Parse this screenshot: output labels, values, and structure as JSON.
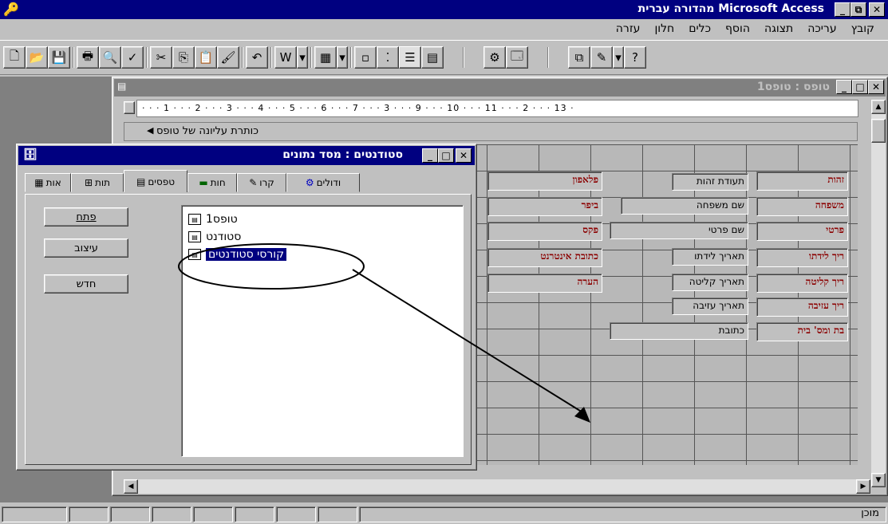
{
  "window": {
    "title": "Microsoft Access מהדורה עברית"
  },
  "menu": {
    "items": [
      "קובץ",
      "עריכה",
      "תצוגה",
      "הוסף",
      "כלים",
      "חלון",
      "עזרה"
    ]
  },
  "form_window": {
    "title": "טופס : טופס1"
  },
  "form_header_label": "כותרת עליונה של טופס",
  "ruler": {
    "numbers": [
      "13",
      "2",
      "11",
      "10",
      "9",
      "3",
      "7",
      "6",
      "5",
      "4",
      "3",
      "2",
      "1"
    ]
  },
  "form_fields": {
    "labels_red": [
      "זהות",
      "משפחה",
      "פרטי",
      "ריך לידתו",
      "ריך קליטה",
      "ריך עזיבה",
      "בת ומס' בית",
      "פלאפון",
      "ביפר",
      "פקס",
      "כתובת אינטרנט",
      "הערה"
    ],
    "labels_black": [
      "תעודת זהות",
      "שם משפחה",
      "שם פרטי",
      "תאריך לידתו",
      "תאריך קליטה",
      "תאריך עזיבה",
      "כתובת"
    ]
  },
  "db_window": {
    "title": "סטודנטים : מסד נתונים",
    "tabs": [
      "טבלאות",
      "שאילתות",
      "טפסים",
      "דוחות",
      "פקרו",
      "מודולים"
    ],
    "tab_visible_labels": [
      "אות",
      "תות",
      "טפסים",
      "חות",
      "קרו",
      "ודולים"
    ],
    "buttons": {
      "open": "פתח",
      "design": "עיצוב",
      "new": "חדש"
    },
    "items": [
      "טופס1",
      "סטודנט",
      "קורסי סטודנטים"
    ]
  },
  "status_bar": {
    "text": "מוכן"
  },
  "colors": {
    "title_bg": "#000080",
    "field_red": "#8b0000",
    "face": "#c0c0c0"
  }
}
